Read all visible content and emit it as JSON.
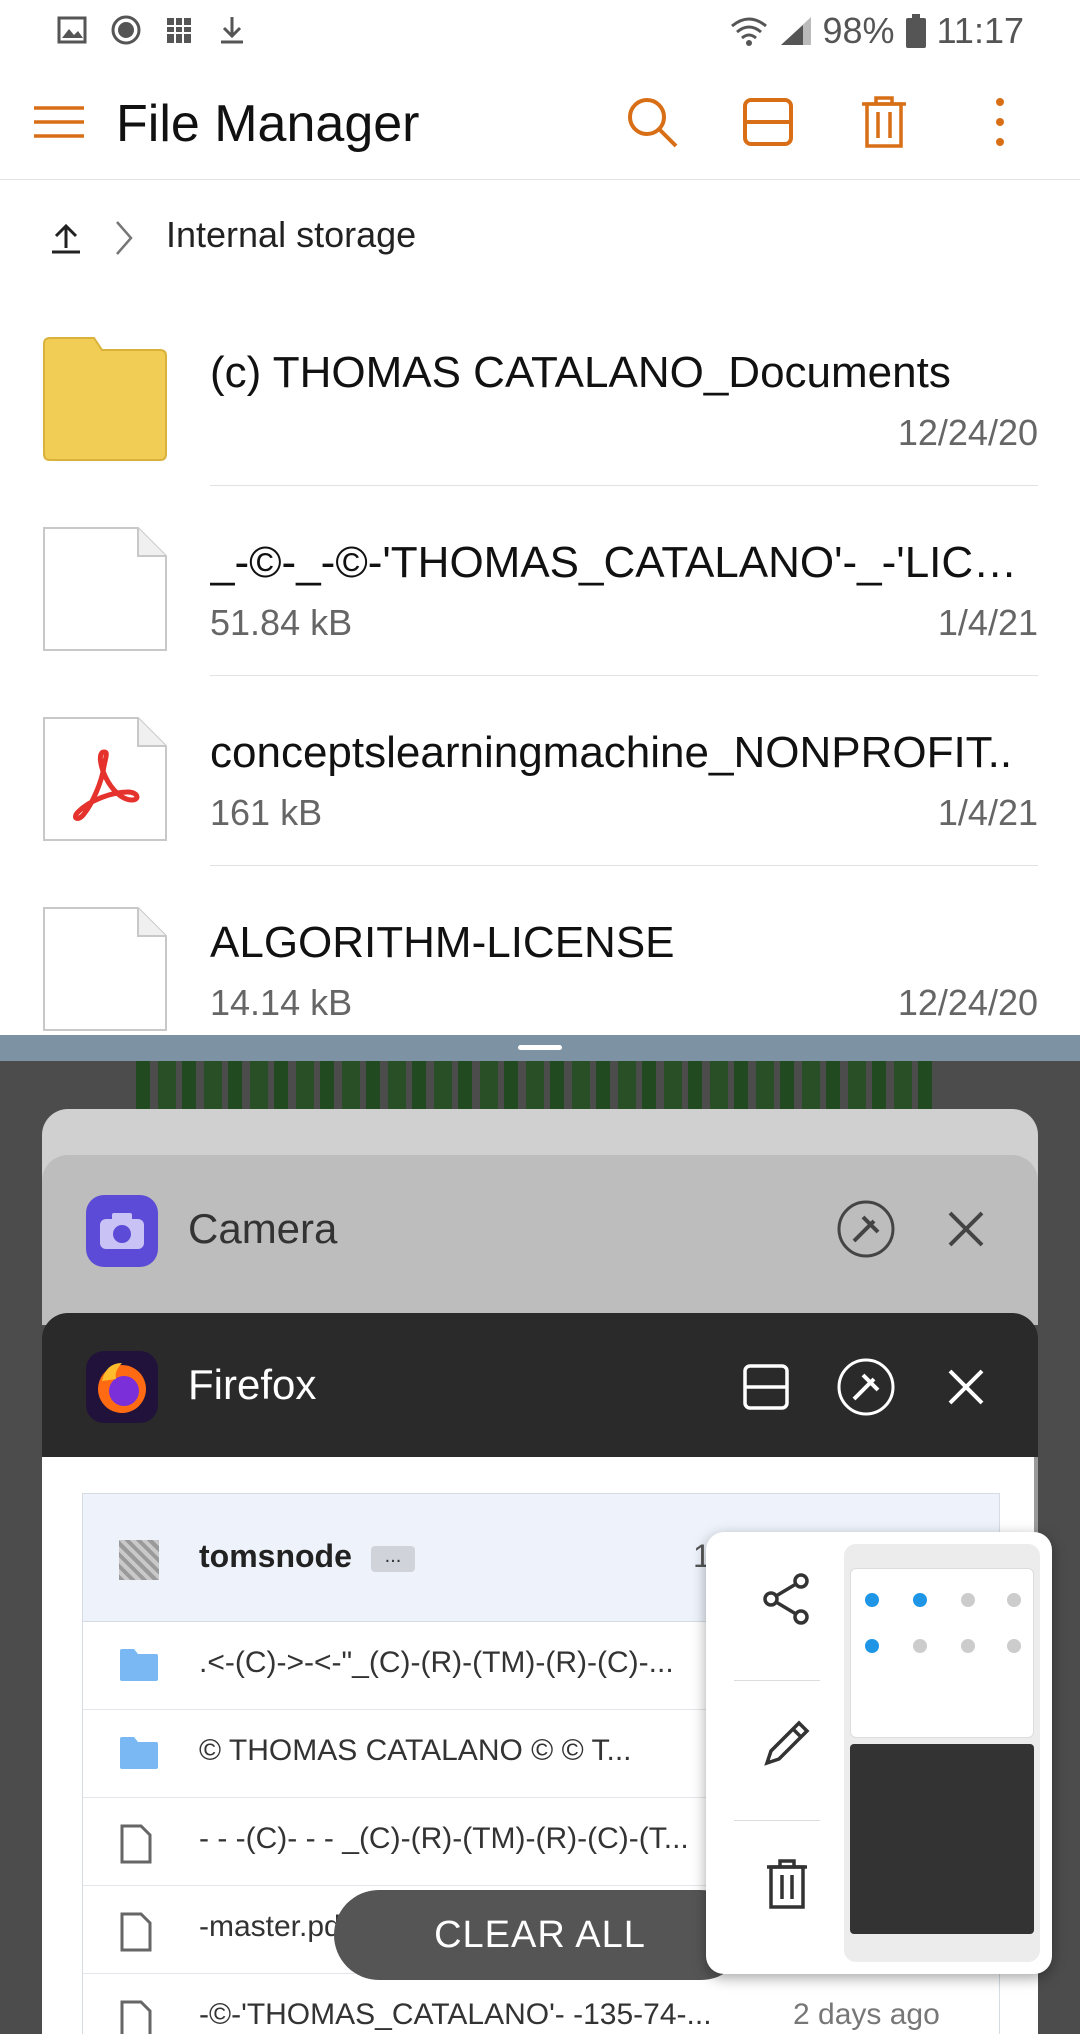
{
  "status": {
    "battery": "98%",
    "time": "11:17"
  },
  "appbar": {
    "title": "File Manager"
  },
  "breadcrumb": {
    "location": "Internal storage"
  },
  "files": [
    {
      "name": "(c) THOMAS CATALANO_Documents",
      "size": "",
      "date": "12/24/20",
      "type": "folder"
    },
    {
      "name": "_-©-_-©-'THOMAS_CATALANO'-_-'LICEN..",
      "size": "51.84 kB",
      "date": "1/4/21",
      "type": "file"
    },
    {
      "name": "conceptslearningmachine_NONPROFIT..",
      "size": "161 kB",
      "date": "1/4/21",
      "type": "pdf"
    },
    {
      "name": "ALGORITHM-LICENSE",
      "size": "14.14 kB",
      "date": "12/24/20",
      "type": "file"
    }
  ],
  "recents": {
    "camera": {
      "label": "Camera"
    },
    "firefox": {
      "label": "Firefox",
      "header": {
        "user": "tomsnode",
        "more": "...",
        "time": "10 m"
      },
      "rows": [
        {
          "text": ".<-(C)->-<-\"_(C)-(R)-(TM)-(R)-(C)-...",
          "age": "",
          "kind": "folder"
        },
        {
          "text": "© THOMAS CATALANO © © T...",
          "age": "",
          "kind": "folder"
        },
        {
          "text": "- - -(C)- - - _(C)-(R)-(TM)-(R)-(C)-(T...",
          "age": "",
          "kind": "file"
        },
        {
          "text": "-master.pdf",
          "age": "",
          "kind": "file"
        },
        {
          "text": "-©-'THOMAS_CATALANO'- -135-74-...",
          "age": "2 days ago",
          "kind": "file"
        }
      ]
    },
    "clear_all": "CLEAR ALL"
  },
  "colors": {
    "accent": "#d86f16",
    "folder": "#f2cd55",
    "pdf_red": "#e5322d"
  }
}
